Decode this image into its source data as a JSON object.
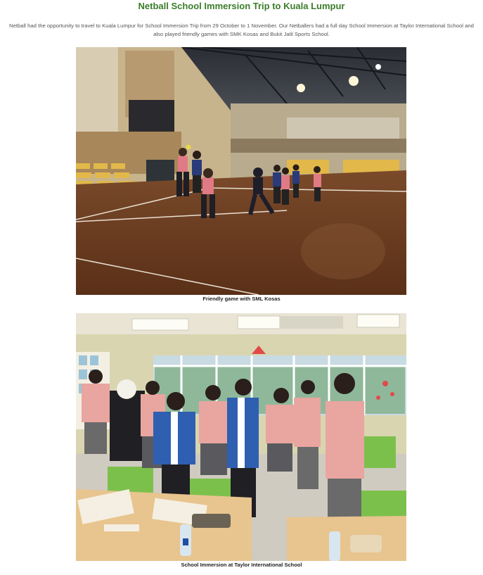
{
  "article": {
    "title": "Netball School Immersion Trip to Kuala Lumpur",
    "intro": "Netball had the opportunity to travel to Kuala Lumpur for School Immersion Trip from 29 October to 1 November. Our Netballers had a full day School Immersion at Taylor International School and also played friendly games with SMK Kosas and Bukit Jalil Sports School."
  },
  "photos": [
    {
      "caption": "Friendly game with SML Kosas"
    },
    {
      "caption": "School Immersion at Taylor International School"
    }
  ]
}
